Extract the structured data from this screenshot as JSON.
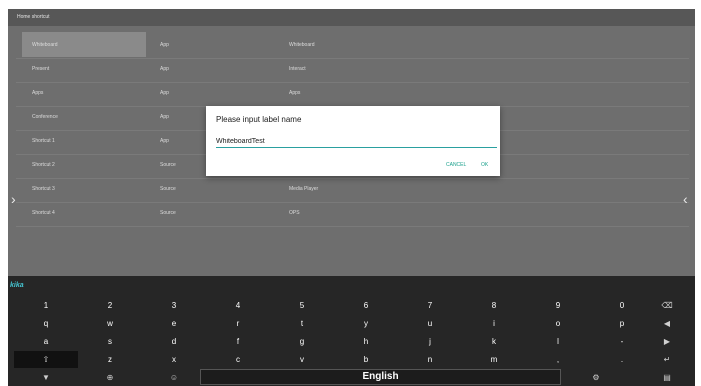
{
  "header": {
    "title": "Home shortcut"
  },
  "rows": [
    {
      "label": "Whiteboard",
      "type": "App",
      "target": "Whiteboard"
    },
    {
      "label": "Present",
      "type": "App",
      "target": "Interact"
    },
    {
      "label": "Apps",
      "type": "App",
      "target": "Apps"
    },
    {
      "label": "Conference",
      "type": "App",
      "target": ""
    },
    {
      "label": "Shortcut 1",
      "type": "App",
      "target": ""
    },
    {
      "label": "Shortcut 2",
      "type": "Source",
      "target": ""
    },
    {
      "label": "Shortcut 3",
      "type": "Source",
      "target": "Media Player"
    },
    {
      "label": "Shortcut 4",
      "type": "Source",
      "target": "OPS"
    }
  ],
  "nav": {
    "left": "›",
    "right": "‹"
  },
  "dialog": {
    "title": "Please input label name",
    "input_value": "WhiteboardTest",
    "cancel_label": "CANCEL",
    "ok_label": "OK"
  },
  "keyboard": {
    "brand": "kika",
    "row1": [
      "1",
      "2",
      "3",
      "4",
      "5",
      "6",
      "7",
      "8",
      "9",
      "0"
    ],
    "row2": [
      "q",
      "w",
      "e",
      "r",
      "t",
      "y",
      "u",
      "i",
      "o",
      "p"
    ],
    "row3": [
      "a",
      "s",
      "d",
      "f",
      "g",
      "h",
      "j",
      "k",
      "l",
      "-"
    ],
    "row4": [
      "z",
      "x",
      "c",
      "v",
      "b",
      "n",
      "m",
      ",",
      "."
    ],
    "fn": {
      "backspace": "⌫",
      "left": "◀",
      "right": "▶",
      "enter": "↵",
      "menu": "▤",
      "shift": "⇧",
      "hide": "▼",
      "globe": "⊕",
      "emoji": "☺",
      "settings": "⚙"
    },
    "space_label": "English"
  }
}
